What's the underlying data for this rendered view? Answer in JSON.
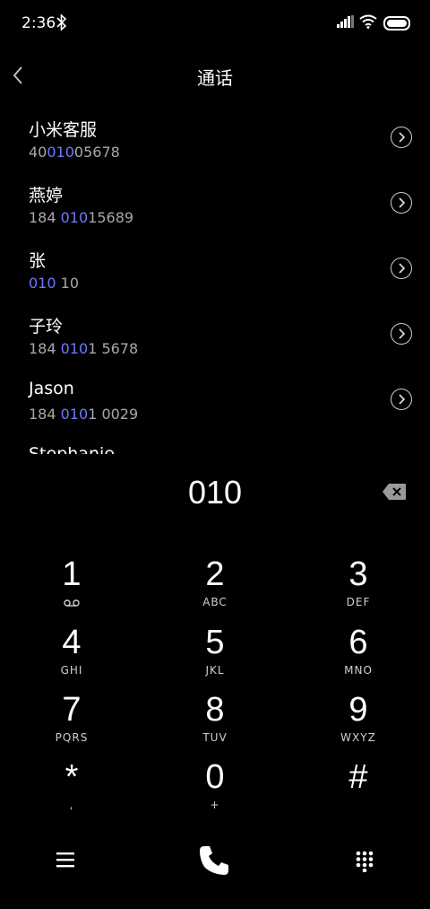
{
  "status": {
    "time": "2:36"
  },
  "header": {
    "title": "通话"
  },
  "contacts": [
    {
      "name": "小米客服",
      "num_parts": [
        "40",
        "010",
        "05678"
      ]
    },
    {
      "name": "燕婷",
      "num_parts": [
        "184 ",
        "010",
        "15689"
      ]
    },
    {
      "name": "张",
      "num_parts": [
        "",
        "010",
        " 10"
      ]
    },
    {
      "name": "子玲",
      "num_parts": [
        "184 ",
        "010",
        "1 5678"
      ]
    },
    {
      "name": "Jason",
      "num_parts": [
        "184 ",
        "010",
        "1 0029"
      ]
    },
    {
      "name": "Stephanie",
      "num_parts": [
        "",
        "",
        ""
      ]
    }
  ],
  "display": {
    "digits": "010"
  },
  "keys": [
    {
      "digit": "1",
      "letters": ""
    },
    {
      "digit": "2",
      "letters": "ABC"
    },
    {
      "digit": "3",
      "letters": "DEF"
    },
    {
      "digit": "4",
      "letters": "GHI"
    },
    {
      "digit": "5",
      "letters": "JKL"
    },
    {
      "digit": "6",
      "letters": "MNO"
    },
    {
      "digit": "7",
      "letters": "PQRS"
    },
    {
      "digit": "8",
      "letters": "TUV"
    },
    {
      "digit": "9",
      "letters": "WXYZ"
    },
    {
      "digit": "*",
      "letters": ","
    },
    {
      "digit": "0",
      "letters": "+"
    },
    {
      "digit": "#",
      "letters": ""
    }
  ],
  "icons": {
    "voicemail": "voicemail-icon",
    "delete": "backspace-icon",
    "call": "phone-icon",
    "menu": "menu-icon",
    "dialpad": "dialpad-icon"
  },
  "colors": {
    "highlight": "#6f79ff",
    "background": "#000000"
  }
}
